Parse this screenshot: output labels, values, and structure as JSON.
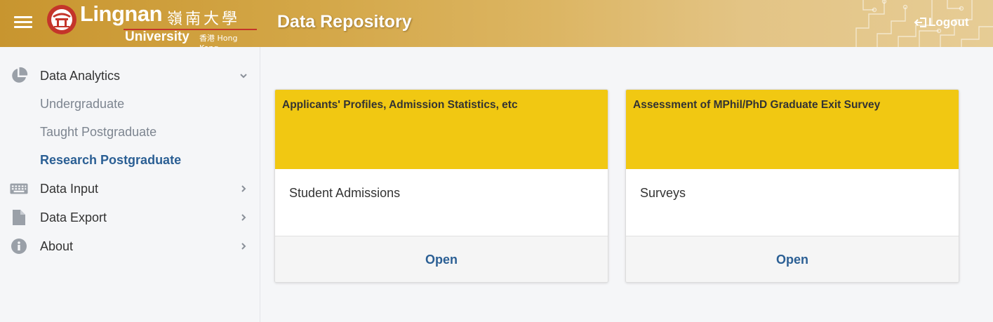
{
  "header": {
    "logo": {
      "name": "Lingnan",
      "chinese": "嶺南大學",
      "university": "University",
      "hong_kong": "香港 Hong Kong"
    },
    "title": "Data Repository",
    "logout_label": "Logout",
    "colors": {
      "gold_start": "#c8952f",
      "gold_end": "#e6cc95",
      "seal_red": "#c4352a"
    }
  },
  "sidebar": {
    "data_analytics": {
      "label": "Data Analytics",
      "icon": "pie-chart-icon",
      "expanded": true,
      "children": [
        {
          "label": "Undergraduate",
          "active": false
        },
        {
          "label": "Taught Postgraduate",
          "active": false
        },
        {
          "label": "Research Postgraduate",
          "active": true
        }
      ]
    },
    "data_input": {
      "label": "Data Input",
      "icon": "keyboard-icon"
    },
    "data_export": {
      "label": "Data Export",
      "icon": "file-icon"
    },
    "about": {
      "label": "About",
      "icon": "info-icon"
    }
  },
  "cards": [
    {
      "title": "Applicants' Profiles, Admission Statistics, etc",
      "category": "Student Admissions",
      "action": "Open"
    },
    {
      "title": "Assessment of MPhil/PhD Graduate Exit Survey",
      "category": "Surveys",
      "action": "Open"
    }
  ],
  "colors": {
    "accent_blue": "#2b5f94",
    "card_header_yellow": "#f1c812"
  }
}
